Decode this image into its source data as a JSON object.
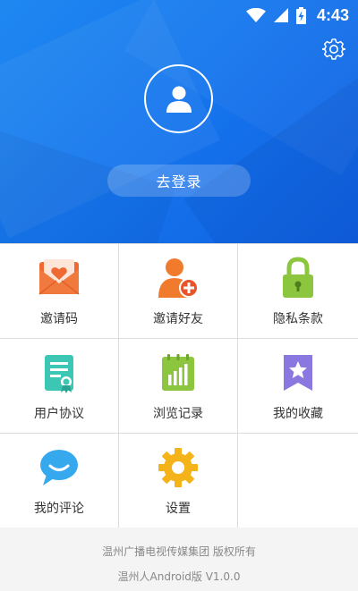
{
  "status_bar": {
    "time": "4:43",
    "icons": [
      "wifi-icon",
      "cellular-signal-icon",
      "battery-charging-icon"
    ]
  },
  "header": {
    "settings_icon": "gear-icon",
    "avatar_icon": "user-icon",
    "login_label": "去登录"
  },
  "menu": {
    "items": [
      {
        "label": "邀请码",
        "icon": "envelope-heart-icon",
        "color": "#ef6a32"
      },
      {
        "label": "邀请好友",
        "icon": "add-friend-icon",
        "color": "#f07b2c"
      },
      {
        "label": "隐私条款",
        "icon": "lock-icon",
        "color": "#8cc63e"
      },
      {
        "label": "用户协议",
        "icon": "certificate-icon",
        "color": "#3cc6b4"
      },
      {
        "label": "浏览记录",
        "icon": "history-chart-icon",
        "color": "#8cc63e"
      },
      {
        "label": "我的收藏",
        "icon": "bookmark-star-icon",
        "color": "#8a78e0"
      },
      {
        "label": "我的评论",
        "icon": "chat-bubble-icon",
        "color": "#35a8ee"
      },
      {
        "label": "设置",
        "icon": "settings-gear-icon",
        "color": "#f5b31a"
      }
    ]
  },
  "footer": {
    "copyright": "温州广播电视传媒集团 版权所有",
    "version": "温州人Android版 V1.0.0"
  },
  "colors": {
    "header_bg": "#1677ee",
    "footer_bg": "#f4f4f4",
    "grid_line": "#dcdcdc"
  }
}
